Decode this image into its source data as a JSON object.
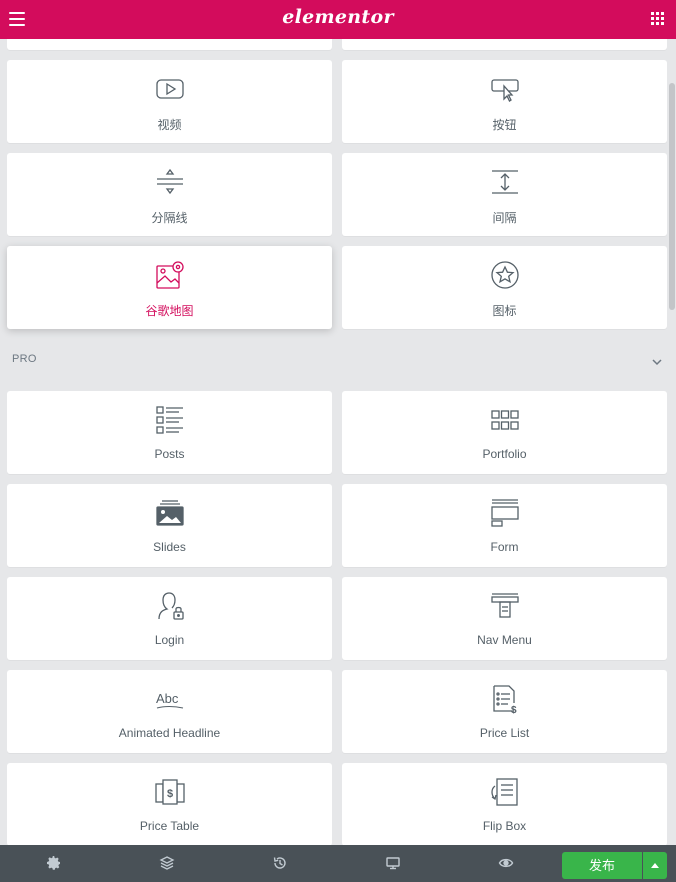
{
  "app": {
    "logo": "elementor"
  },
  "icons": {
    "menu": "hamburger-icon",
    "apps": "grid-icon",
    "settings": "gear-icon",
    "navigator": "layers-icon",
    "history": "history-icon",
    "responsive": "desktop-icon",
    "preview": "eye-icon",
    "publish_options": "caret-up-icon"
  },
  "colors": {
    "brand": "#d30c5c",
    "footer": "#495157",
    "publish": "#39b54a",
    "background": "#e6e7e9"
  },
  "widgets_basic": [
    {
      "label": "视频",
      "icon": "video-icon"
    },
    {
      "label": "按钮",
      "icon": "button-icon"
    },
    {
      "label": "分隔线",
      "icon": "divider-icon"
    },
    {
      "label": "间隔",
      "icon": "spacer-icon"
    },
    {
      "label": "谷歌地图",
      "icon": "google-maps-icon",
      "active": true
    },
    {
      "label": "图标",
      "icon": "star-icon"
    }
  ],
  "pro_section": {
    "title": "PRO"
  },
  "widgets_pro": [
    {
      "label": "Posts",
      "icon": "posts-icon"
    },
    {
      "label": "Portfolio",
      "icon": "portfolio-icon"
    },
    {
      "label": "Slides",
      "icon": "slides-icon"
    },
    {
      "label": "Form",
      "icon": "form-icon"
    },
    {
      "label": "Login",
      "icon": "login-icon"
    },
    {
      "label": "Nav Menu",
      "icon": "nav-menu-icon"
    },
    {
      "label": "Animated Headline",
      "icon": "animated-headline-icon"
    },
    {
      "label": "Price List",
      "icon": "price-list-icon"
    },
    {
      "label": "Price Table",
      "icon": "price-table-icon"
    },
    {
      "label": "Flip Box",
      "icon": "flip-box-icon"
    }
  ],
  "footer": {
    "publish_label": "发布"
  }
}
